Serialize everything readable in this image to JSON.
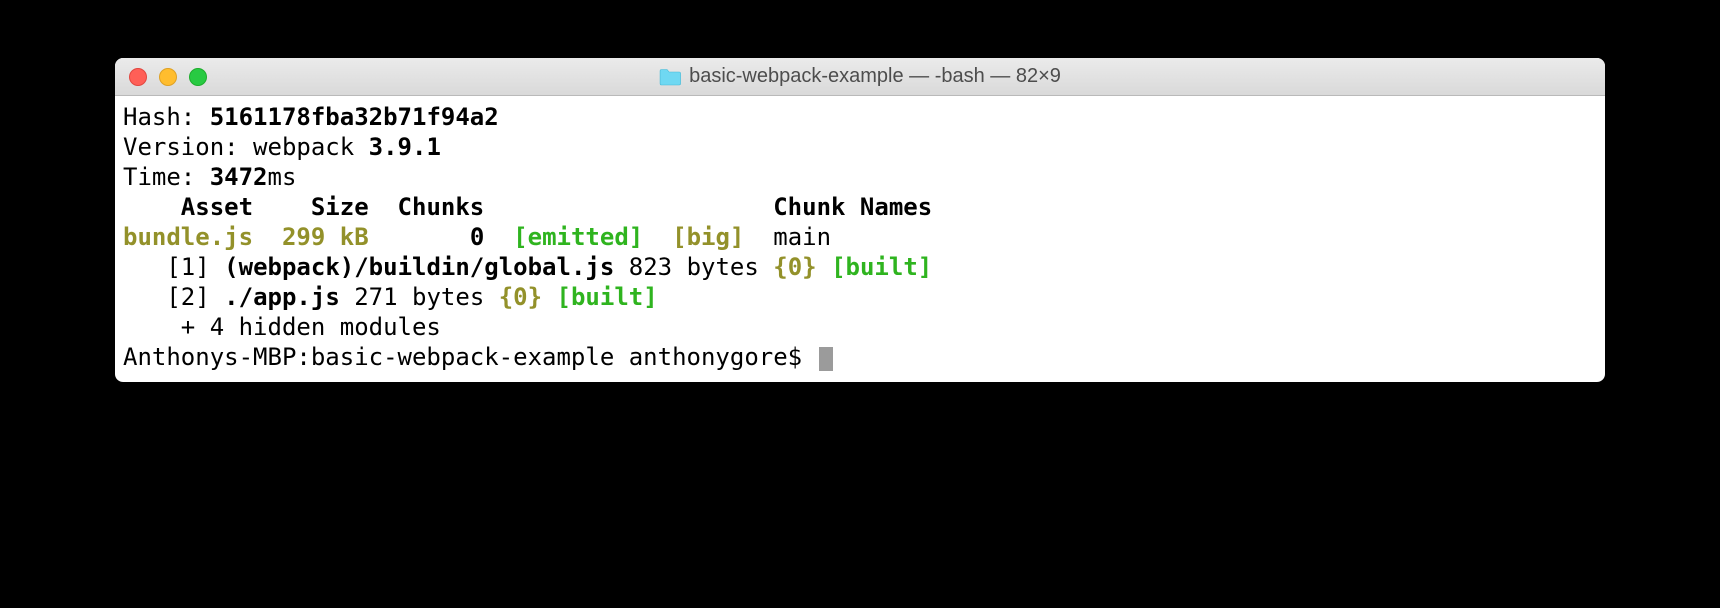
{
  "window_title": "basic-webpack-example — -bash — 82×9",
  "output": {
    "hash_label": "Hash: ",
    "hash_value": "5161178fba32b71f94a2",
    "version_label": "Version: webpack ",
    "version_value": "3.9.1",
    "time_label": "Time: ",
    "time_value": "3472",
    "time_unit": "ms",
    "header_asset": "Asset",
    "header_size": "Size",
    "header_chunks": "Chunks",
    "header_chunk_names": "Chunk Names",
    "row_asset": "bundle.js",
    "row_size": "299 kB",
    "row_chunk_num": "0",
    "row_emitted": "[emitted]",
    "row_big": "[big]",
    "row_chunk_name": "main",
    "mod1_idx": "[1]",
    "mod1_name": "(webpack)/buildin/global.js",
    "mod1_size": "823 bytes",
    "mod1_group_open": "{",
    "mod1_group_num": "0",
    "mod1_group_close": "}",
    "mod1_built": "[built]",
    "mod2_idx": "[2]",
    "mod2_name": "./app.js",
    "mod2_size": "271 bytes",
    "mod2_group_open": "{",
    "mod2_group_num": "0",
    "mod2_group_close": "}",
    "mod2_built": "[built]",
    "hidden_modules": "    + 4 hidden modules",
    "prompt": "Anthonys-MBP:basic-webpack-example anthonygore$ "
  }
}
